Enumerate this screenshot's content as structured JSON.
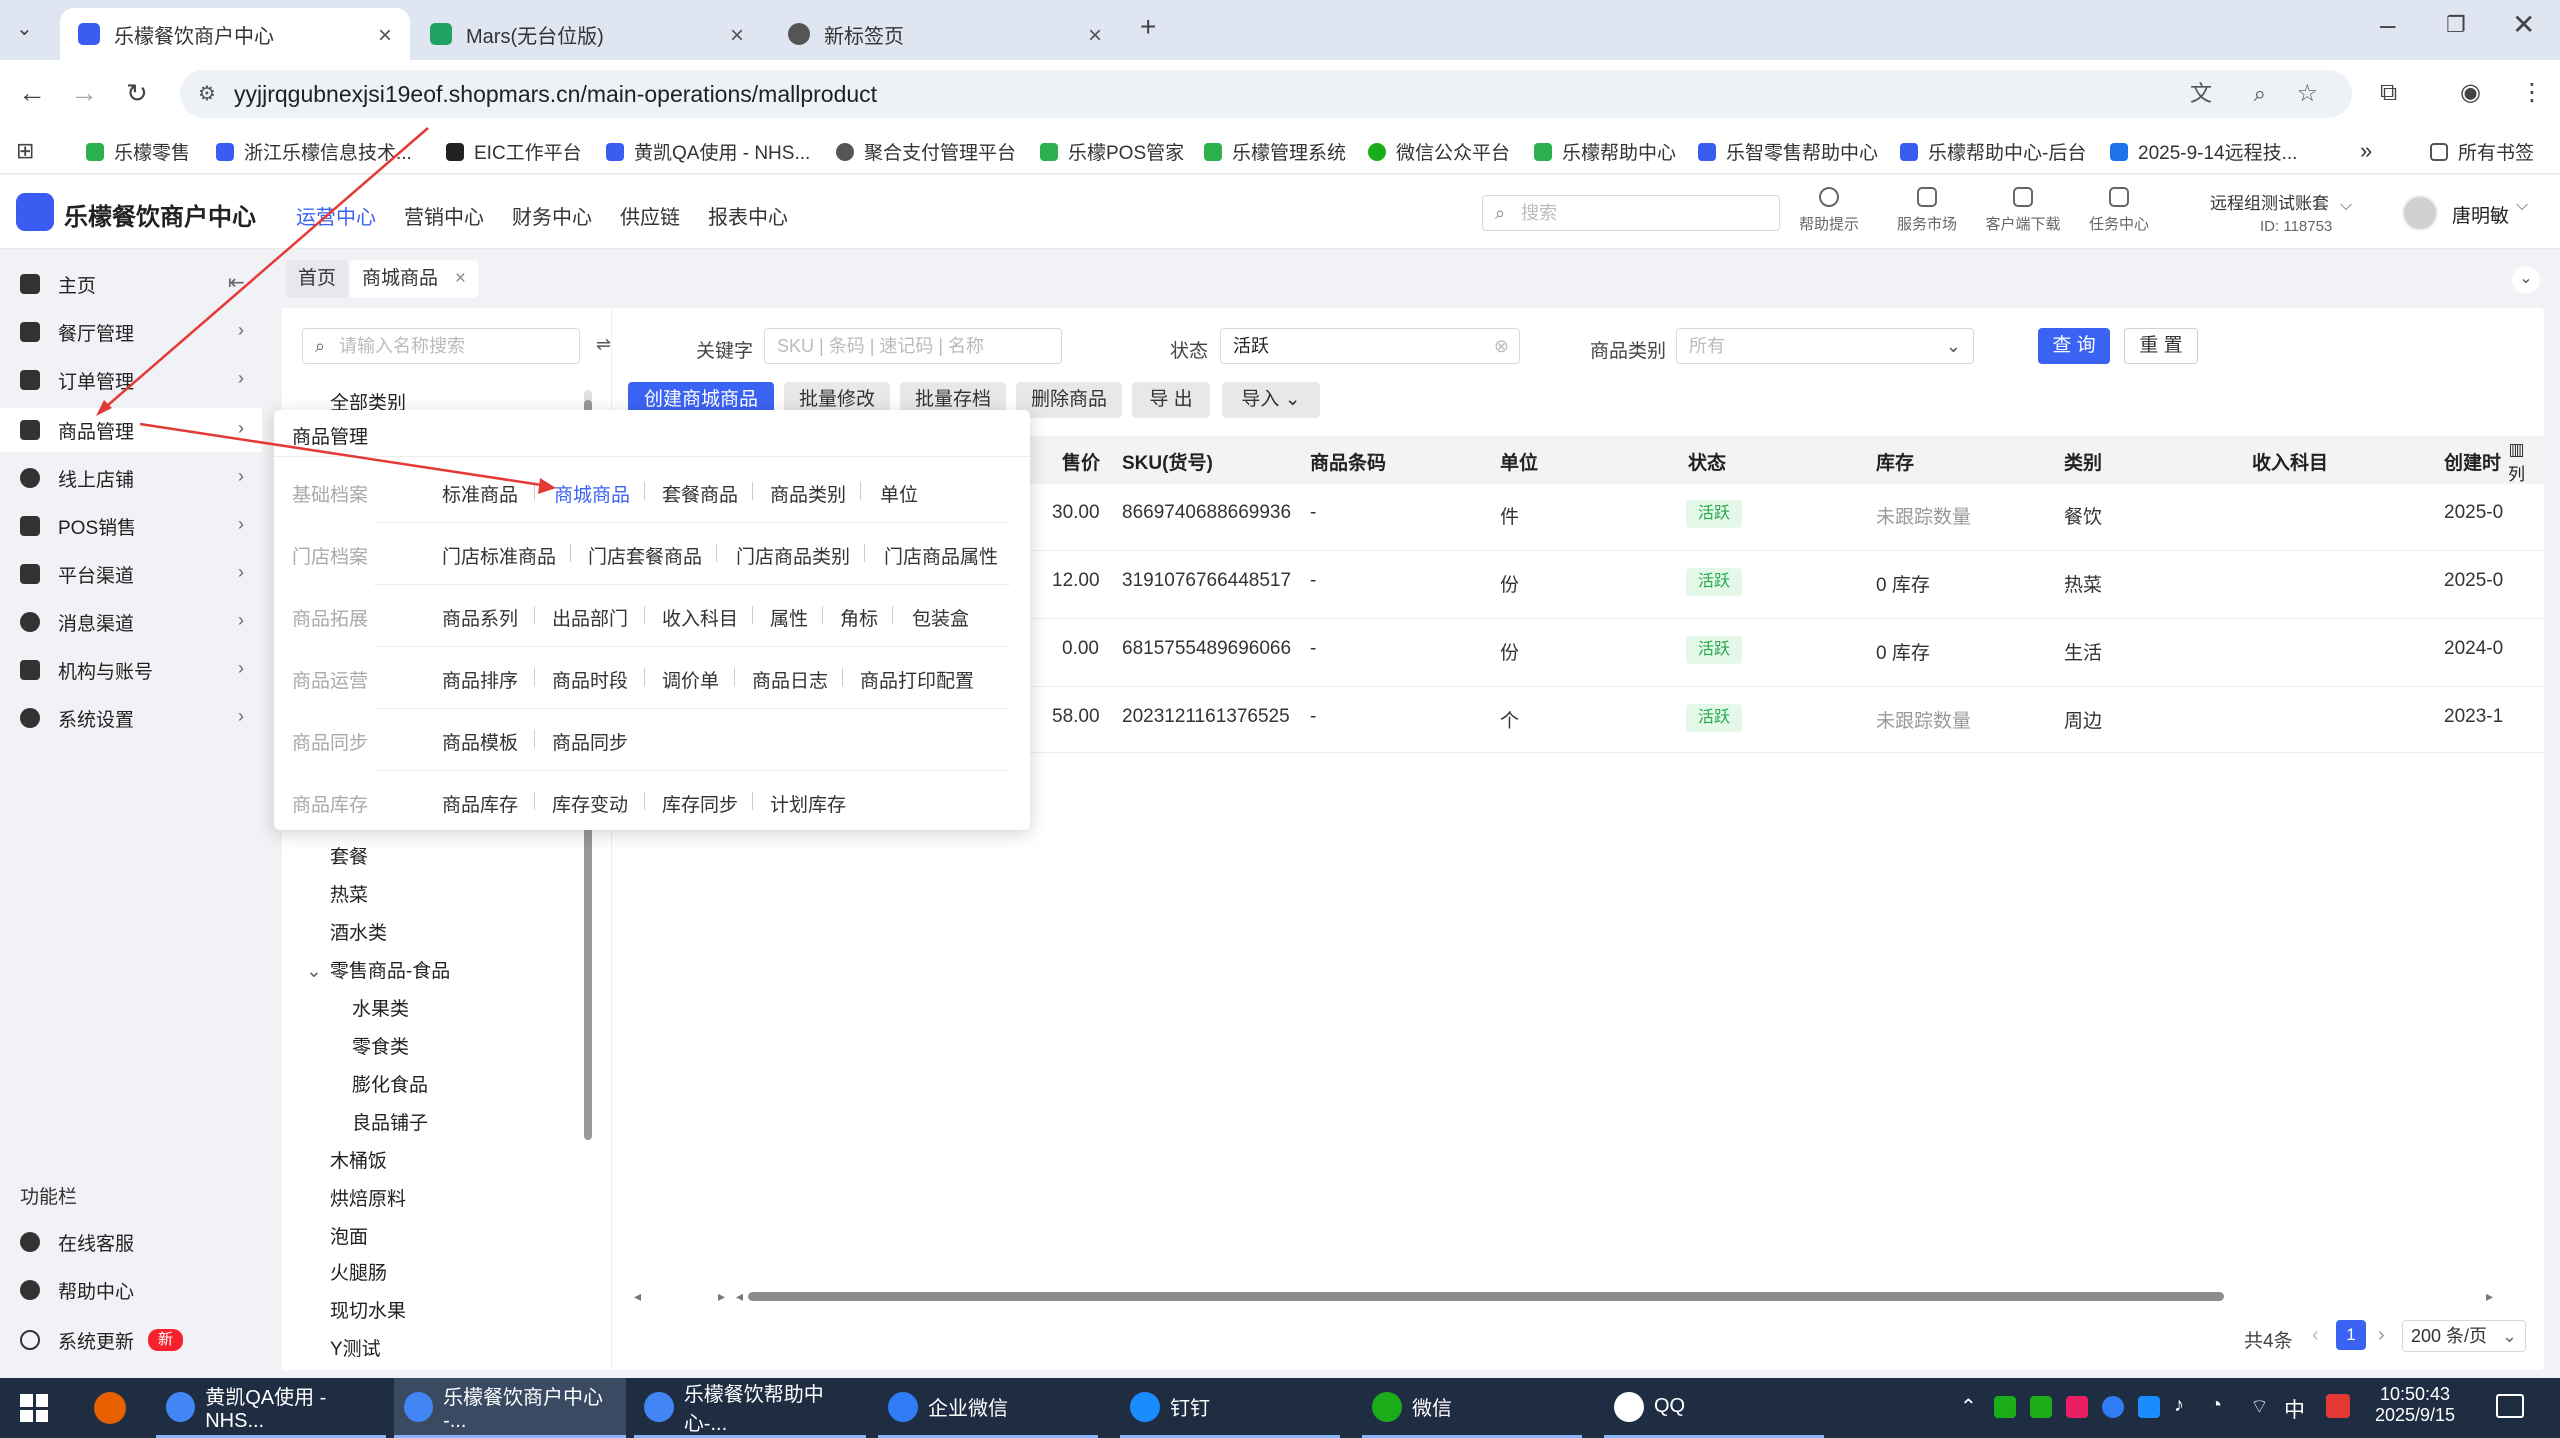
{
  "browser": {
    "tabs": [
      {
        "label": "乐檬餐饮商户中心",
        "color": "#3b5cf0"
      },
      {
        "label": "Mars(无台位版)",
        "color": "#1ea362"
      },
      {
        "label": "新标签页",
        "color": "#555555"
      }
    ],
    "url": "yyjjrqgubnexjsi19eof.shopmars.cn/main-operations/mallproduct",
    "bookmarks": [
      "乐檬零售",
      "浙江乐檬信息技术...",
      "EIC工作平台",
      "黄凯QA使用 - NHS...",
      "聚合支付管理平台",
      "乐檬POS管家",
      "乐檬管理系统",
      "微信公众平台",
      "乐檬帮助中心",
      "乐智零售帮助中心",
      "乐檬帮助中心-后台",
      "2025-9-14远程技..."
    ],
    "all_bookmarks": "所有书签"
  },
  "app": {
    "name": "乐檬餐饮商户中心",
    "top_nav": [
      "运营中心",
      "营销中心",
      "财务中心",
      "供应链",
      "报表中心"
    ],
    "search_placeholder": "搜索",
    "header_icons": [
      "帮助提示",
      "服务市场",
      "客户端下载",
      "任务中心"
    ],
    "account": {
      "name": "远程组测试账套",
      "id": "ID: 118753"
    },
    "user": "唐明敏"
  },
  "sidebar": {
    "items": [
      "主页",
      "餐厅管理",
      "订单管理",
      "商品管理",
      "线上店铺",
      "POS销售",
      "平台渠道",
      "消息渠道",
      "机构与账号",
      "系统设置"
    ],
    "function_bar": "功能栏",
    "bottom": [
      "在线客服",
      "帮助中心",
      "系统更新"
    ],
    "new_badge": "新"
  },
  "page_tabs": [
    "首页",
    "商城商品"
  ],
  "tree": {
    "search_placeholder": "请输入名称搜索",
    "nodes": [
      "全部类别",
      "套餐",
      "热菜",
      "酒水类",
      "零售商品-食品",
      "水果类",
      "零食类",
      "膨化食品",
      "良品铺子",
      "木桶饭",
      "烘焙原料",
      "泡面",
      "火腿肠",
      "现切水果",
      "Y测试"
    ]
  },
  "filters": {
    "keyword_label": "关键字",
    "keyword_placeholder": "SKU | 条码 | 速记码 | 名称",
    "status_label": "状态",
    "status_value": "活跃",
    "category_label": "商品类别",
    "category_value": "所有",
    "query": "查 询",
    "reset": "重 置"
  },
  "actions": [
    "创建商城商品",
    "批量修改",
    "批量存档",
    "删除商品",
    "导 出",
    "导入"
  ],
  "table": {
    "headers": [
      "售价",
      "SKU(货号)",
      "商品条码",
      "单位",
      "状态",
      "库存",
      "类别",
      "收入科目",
      "创建时",
      "列"
    ],
    "rows": [
      {
        "price": "30.00",
        "sku": "8669740688669936",
        "barcode": "-",
        "unit": "件",
        "status": "活跃",
        "stock": "未跟踪数量",
        "category": "餐饮",
        "created": "2025-0"
      },
      {
        "price": "12.00",
        "sku": "3191076766448517",
        "barcode": "-",
        "unit": "份",
        "status": "活跃",
        "stock": "0 库存",
        "category": "热菜",
        "created": "2025-0"
      },
      {
        "price": "0.00",
        "sku": "6815755489696066",
        "barcode": "-",
        "unit": "份",
        "status": "活跃",
        "stock": "0 库存",
        "category": "生活",
        "created": "2024-0"
      },
      {
        "price": "58.00",
        "sku": "2023121161376525",
        "barcode": "-",
        "unit": "个",
        "status": "活跃",
        "stock": "未跟踪数量",
        "category": "周边",
        "created": "2023-1"
      }
    ]
  },
  "pagination": {
    "total": "共4条",
    "page": "1",
    "page_size": "200 条/页"
  },
  "popup": {
    "title": "商品管理",
    "groups": [
      {
        "label": "基础档案",
        "links": [
          "标准商品",
          "商城商品",
          "套餐商品",
          "商品类别",
          "单位"
        ]
      },
      {
        "label": "门店档案",
        "links": [
          "门店标准商品",
          "门店套餐商品",
          "门店商品类别",
          "门店商品属性"
        ]
      },
      {
        "label": "商品拓展",
        "links": [
          "商品系列",
          "出品部门",
          "收入科目",
          "属性",
          "角标",
          "包装盒"
        ]
      },
      {
        "label": "商品运营",
        "links": [
          "商品排序",
          "商品时段",
          "调价单",
          "商品日志",
          "商品打印配置"
        ]
      },
      {
        "label": "商品同步",
        "links": [
          "商品模板",
          "商品同步"
        ]
      },
      {
        "label": "商品库存",
        "links": [
          "商品库存",
          "库存变动",
          "库存同步",
          "计划库存"
        ]
      }
    ]
  },
  "taskbar": {
    "items": [
      "黄凯QA使用 - NHS...",
      "乐檬餐饮商户中心 -...",
      "乐檬餐饮帮助中心-...",
      "企业微信",
      "钉钉",
      "微信",
      "QQ"
    ],
    "ime": "中",
    "time": "10:50:43",
    "date": "2025/9/15"
  }
}
